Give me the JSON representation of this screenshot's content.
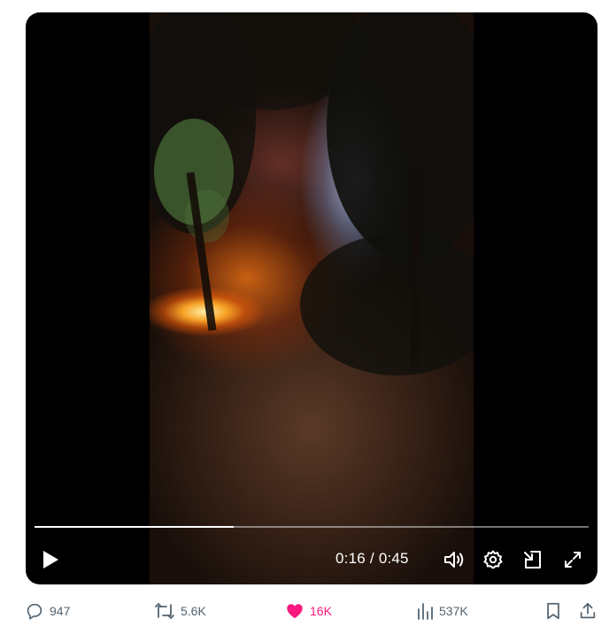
{
  "player": {
    "progress_fraction": 0.36,
    "time_current": "0:16",
    "time_separator": "/",
    "time_total": "0:45",
    "buttons": {
      "play": "play-icon",
      "volume": "volume-icon",
      "settings": "gear-icon",
      "pip": "picture-in-picture-icon",
      "fullscreen": "fullscreen-icon"
    }
  },
  "actions": {
    "replies": {
      "icon": "reply-icon",
      "count": "947"
    },
    "reposts": {
      "icon": "repost-icon",
      "count": "5.6K"
    },
    "likes": {
      "icon": "heart-icon",
      "count": "16K",
      "color": "#f91880"
    },
    "views": {
      "icon": "views-icon",
      "count": "537K"
    },
    "bookmark": {
      "icon": "bookmark-icon"
    },
    "share": {
      "icon": "share-icon"
    }
  },
  "colors": {
    "muted_text": "#536471",
    "like_accent": "#f91880",
    "player_bg": "#000000"
  }
}
